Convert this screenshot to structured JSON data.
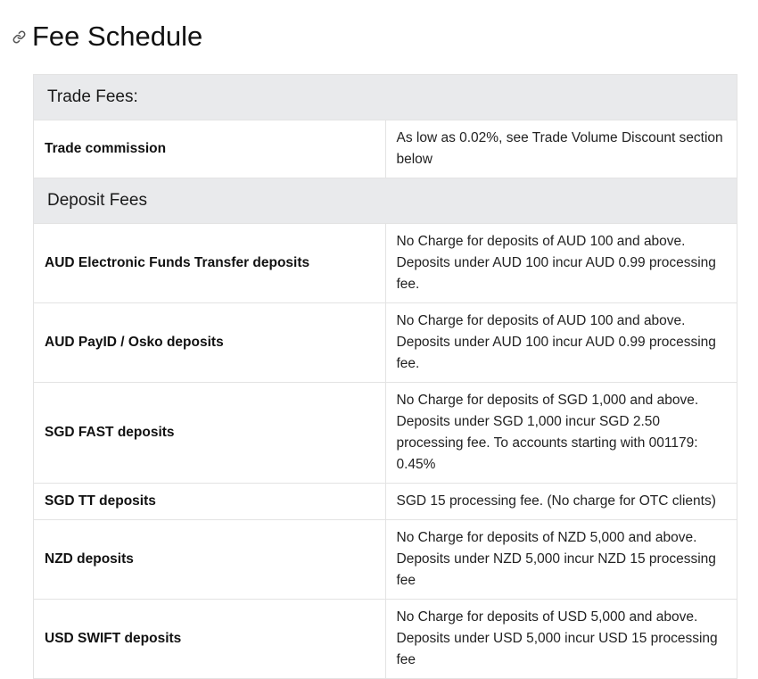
{
  "page": {
    "title": "Fee Schedule",
    "link_icon": "link-icon"
  },
  "sections": [
    {
      "title": "Trade Fees:",
      "rows": [
        {
          "label": "Trade commission",
          "value": "As low as 0.02%, see Trade Volume Discount section below"
        }
      ]
    },
    {
      "title": "Deposit Fees",
      "rows": [
        {
          "label": "AUD Electronic Funds Transfer deposits",
          "value": "No Charge for deposits of AUD 100 and above. Deposits under AUD 100 incur AUD 0.99 processing fee."
        },
        {
          "label": "AUD PayID / Osko deposits",
          "value": "No Charge for deposits of AUD 100 and above. Deposits under AUD 100 incur AUD 0.99 processing fee."
        },
        {
          "label": "SGD FAST deposits",
          "value": "No Charge for deposits of SGD 1,000 and above. Deposits under SGD 1,000 incur SGD 2.50 processing fee. To accounts starting with 001179: 0.45%"
        },
        {
          "label": "SGD TT deposits",
          "value": "SGD 15 processing fee. (No charge for OTC clients)"
        },
        {
          "label": "NZD deposits",
          "value": "No Charge for deposits of NZD 5,000 and above. Deposits under NZD 5,000 incur NZD 15 processing fee"
        },
        {
          "label": "USD SWIFT deposits",
          "value": "No Charge for deposits of USD 5,000 and above. Deposits under USD 5,000 incur USD 15 processing fee"
        }
      ]
    }
  ]
}
